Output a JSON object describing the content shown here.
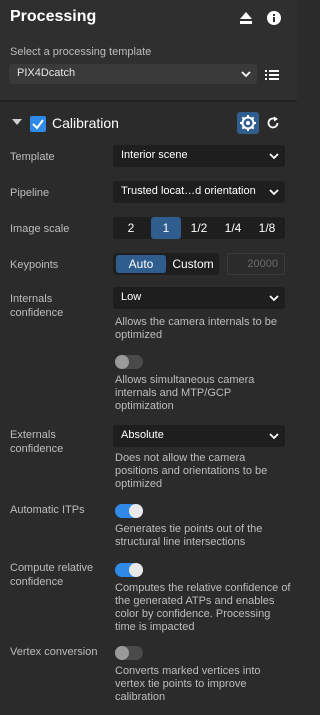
{
  "header": {
    "title": "Processing",
    "select_label": "Select a processing template",
    "template_value": "PIX4Dcatch"
  },
  "section": {
    "title": "Calibration",
    "checked": true
  },
  "fields": {
    "template": {
      "label": "Template",
      "value": "Interior scene"
    },
    "pipeline": {
      "label": "Pipeline",
      "value": "Trusted locat…d orientation"
    },
    "image_scale": {
      "label": "Image scale",
      "options": [
        "2",
        "1",
        "1/2",
        "1/4",
        "1/8"
      ],
      "selected": "1"
    },
    "keypoints": {
      "label": "Keypoints",
      "options": [
        "Auto",
        "Custom"
      ],
      "selected": "Auto",
      "value_placeholder": "20000"
    },
    "internals": {
      "label": "Internals confidence",
      "value": "Low",
      "description": "Allows the camera internals to be optimized",
      "toggle_on": false,
      "toggle_description": "Allows simultaneous camera internals and MTP/GCP optimization"
    },
    "externals": {
      "label": "Externals confidence",
      "value": "Absolute",
      "description": "Does not allow the camera positions and orientations to be optimized"
    },
    "automatic_itps": {
      "label": "Automatic ITPs",
      "toggle_on": true,
      "description": "Generates tie points out of the structural line intersections"
    },
    "relative_confidence": {
      "label": "Compute relative confidence",
      "toggle_on": true,
      "description": "Computes the relative confidence of the generated ATPs and enables color by confidence. Processing time is impacted"
    },
    "vertex_conversion": {
      "label": "Vertex conversion",
      "toggle_on": false,
      "description": "Converts marked vertices into vertex tie points to improve calibration"
    }
  }
}
